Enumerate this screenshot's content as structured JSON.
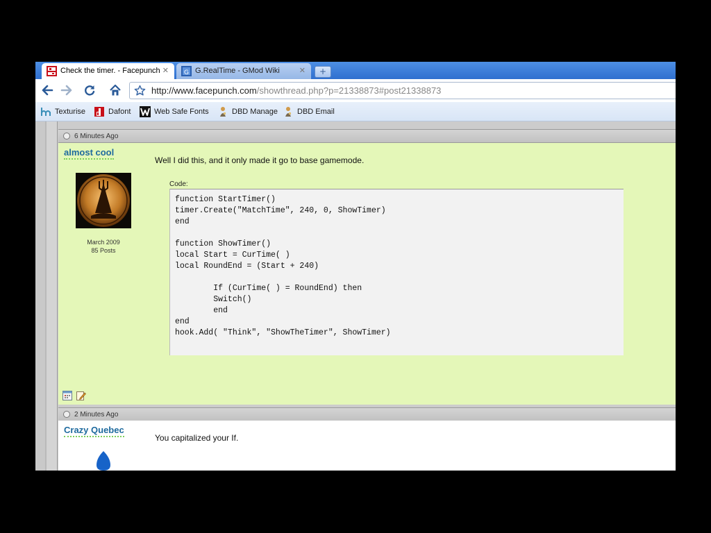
{
  "browser": {
    "tabs": [
      {
        "label": "Check the timer. - Facepunch",
        "icon": "facepunch-favicon-icon",
        "active": true
      },
      {
        "label": "G.RealTime - GMod Wiki",
        "icon": "gmod-wiki-favicon-icon",
        "active": false
      }
    ],
    "tab_close_glyph": "✕",
    "new_tab_glyph": "+",
    "url_host": "http://www.facepunch.com",
    "url_path": "/showthread.php?p=21338873#post21338873",
    "bookmarks": [
      {
        "label": "Texturise",
        "icon": "texturise-icon"
      },
      {
        "label": "Dafont",
        "icon": "dafont-icon"
      },
      {
        "label": "Web Safe Fonts",
        "icon": "web-safe-fonts-icon"
      },
      {
        "label": "DBD Manage",
        "icon": "dbd-icon"
      },
      {
        "label": "DBD Email",
        "icon": "dbd-icon"
      }
    ]
  },
  "posts": [
    {
      "time": "6 Minutes Ago",
      "username": "almost cool",
      "joined": "March 2009",
      "post_count": "85 Posts",
      "message": "Well I did this, and it only made it go to base gamemode.",
      "code_label": "Code:",
      "code": "function StartTimer()\ntimer.Create(\"MatchTime\", 240, 0, ShowTimer)\nend\n\nfunction ShowTimer()\nlocal Start = CurTime( )\nlocal RoundEnd = (Start + 240)\n\n        If (CurTime( ) = RoundEnd) then\n        Switch()\n        end\nend\nhook.Add( \"Think\", \"ShowTheTimer\", ShowTimer)"
    },
    {
      "time": "2 Minutes Ago",
      "username": "Crazy Quebec",
      "message": "You capitalized your If."
    }
  ],
  "colors": {
    "tabstrip": "#3d7fdc",
    "post_highlight": "#e4f7b8",
    "username": "#1e6a9e"
  }
}
